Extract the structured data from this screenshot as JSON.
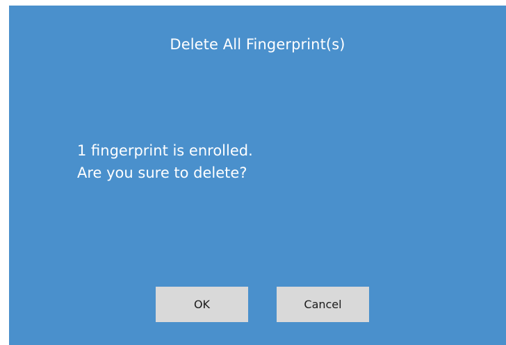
{
  "dialog": {
    "title": "Delete All Fingerprint(s)",
    "message_lines": [
      "1 fingerprint is enrolled.",
      "Are you sure to delete?"
    ],
    "buttons": {
      "ok_label": "OK",
      "cancel_label": "Cancel"
    },
    "colors": {
      "background": "#4a90cc",
      "text": "#ffffff",
      "button_background": "#d9d9d9",
      "button_text": "#1a1a1a"
    }
  }
}
